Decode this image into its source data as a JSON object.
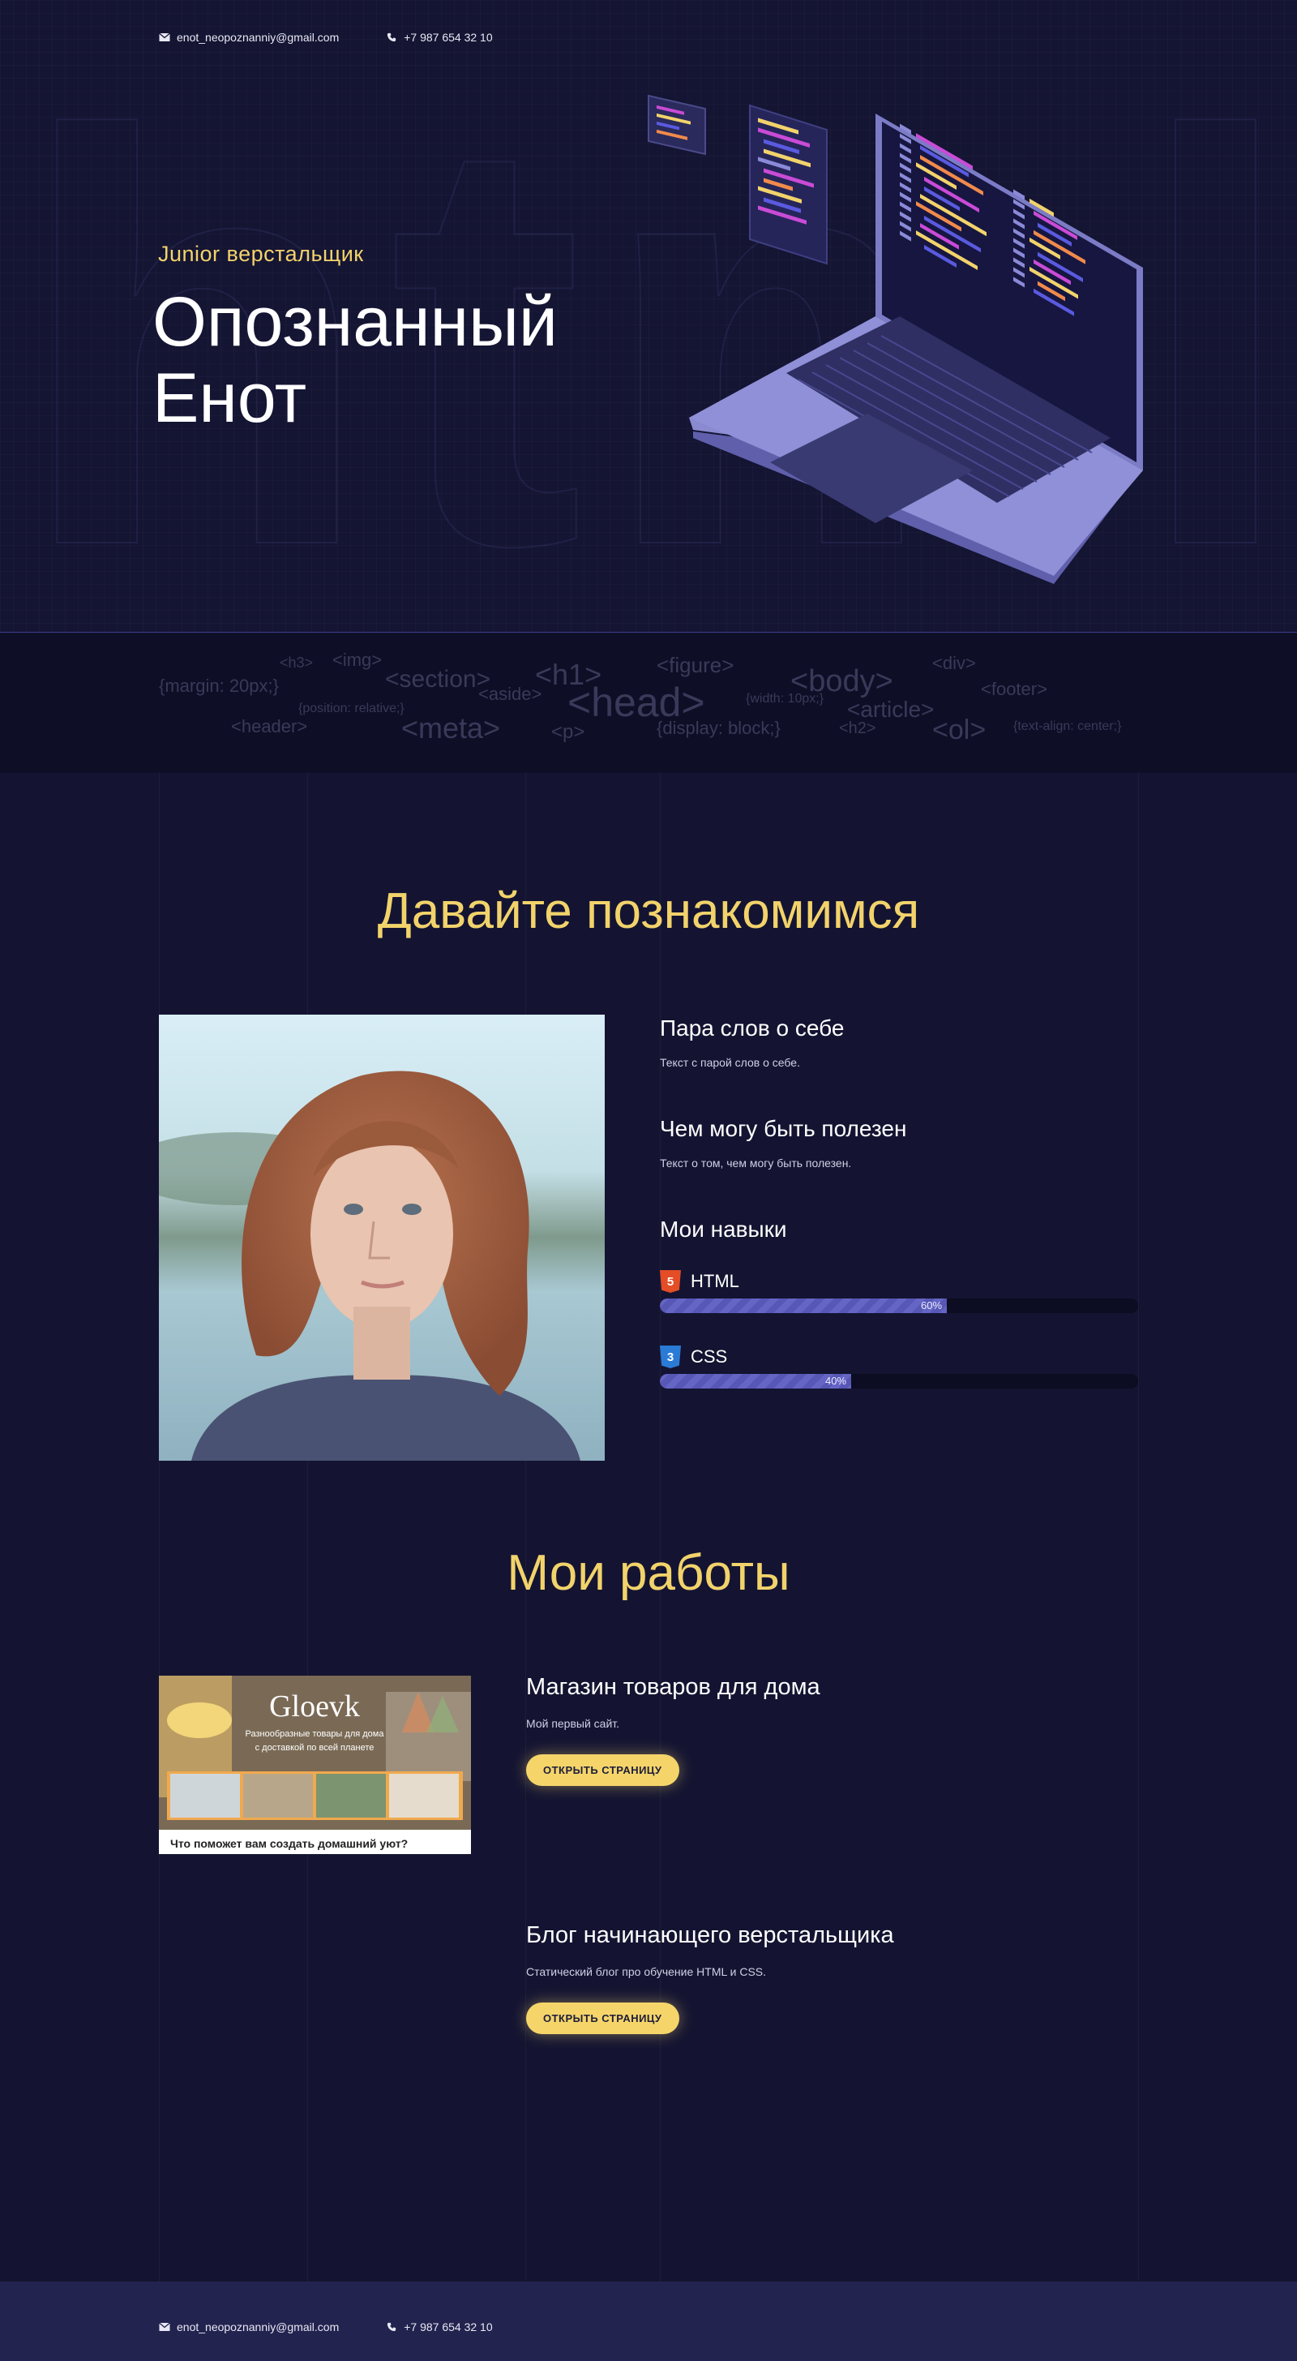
{
  "header": {
    "email": "enot_neopoznanniy@gmail.com",
    "phone": "+7 987 654 32 10"
  },
  "hero": {
    "subtitle": "Junior верстальщик",
    "title_line1": "Опознанный",
    "title_line2": "Енот",
    "ghost_text": "html"
  },
  "tags": [
    "<h3>",
    "<img>",
    "<figure>",
    "<div>",
    "{margin: 20px;}",
    "<section>",
    "<h1>",
    "<body>",
    "<footer>",
    "<aside>",
    "<head>",
    "{width: 10px;}",
    "{position: relative;}",
    "<article>",
    "<header>",
    "<meta>",
    "<p>",
    "{display: block;}",
    "<h2>",
    "<ol>",
    "{text-align: center;}"
  ],
  "about": {
    "title": "Давайте познакомимся",
    "block1": {
      "heading": "Пара слов о себе",
      "text": "Текст с парой слов о себе."
    },
    "block2": {
      "heading": "Чем могу быть полезен",
      "text": "Текст о том, чем могу быть полезен."
    },
    "skills_heading": "Мои навыки",
    "skills": [
      {
        "name": "HTML",
        "badge": "5",
        "percent_label": "60%",
        "value": 60,
        "color": "#e44d26"
      },
      {
        "name": "CSS",
        "badge": "3",
        "percent_label": "40%",
        "value": 40,
        "color": "#2a7bd6"
      }
    ]
  },
  "works": {
    "title": "Мои работы",
    "items": [
      {
        "title": "Магазин товаров для дома",
        "description": "Мой первый сайт.",
        "button": "ОТКРЫТЬ СТРАНИЦУ",
        "preview": {
          "brand": "Gloevk",
          "tagline1": "Разнообразные товары для дома",
          "tagline2": "с доставкой по всей планете",
          "question": "Что поможет вам создать домашний уют?"
        }
      },
      {
        "title": "Блог начинающего верстальщика",
        "description": "Статический блог про обучение HTML и CSS.",
        "button": "ОТКРЫТЬ СТРАНИЦУ"
      }
    ]
  },
  "footer": {
    "email": "enot_neopoznanniy@gmail.com",
    "phone": "+7 987 654 32 10"
  },
  "colors": {
    "background": "#141432",
    "accent": "#f2d36b",
    "bar_fill": "#6060c0",
    "footer": "#23234f"
  }
}
